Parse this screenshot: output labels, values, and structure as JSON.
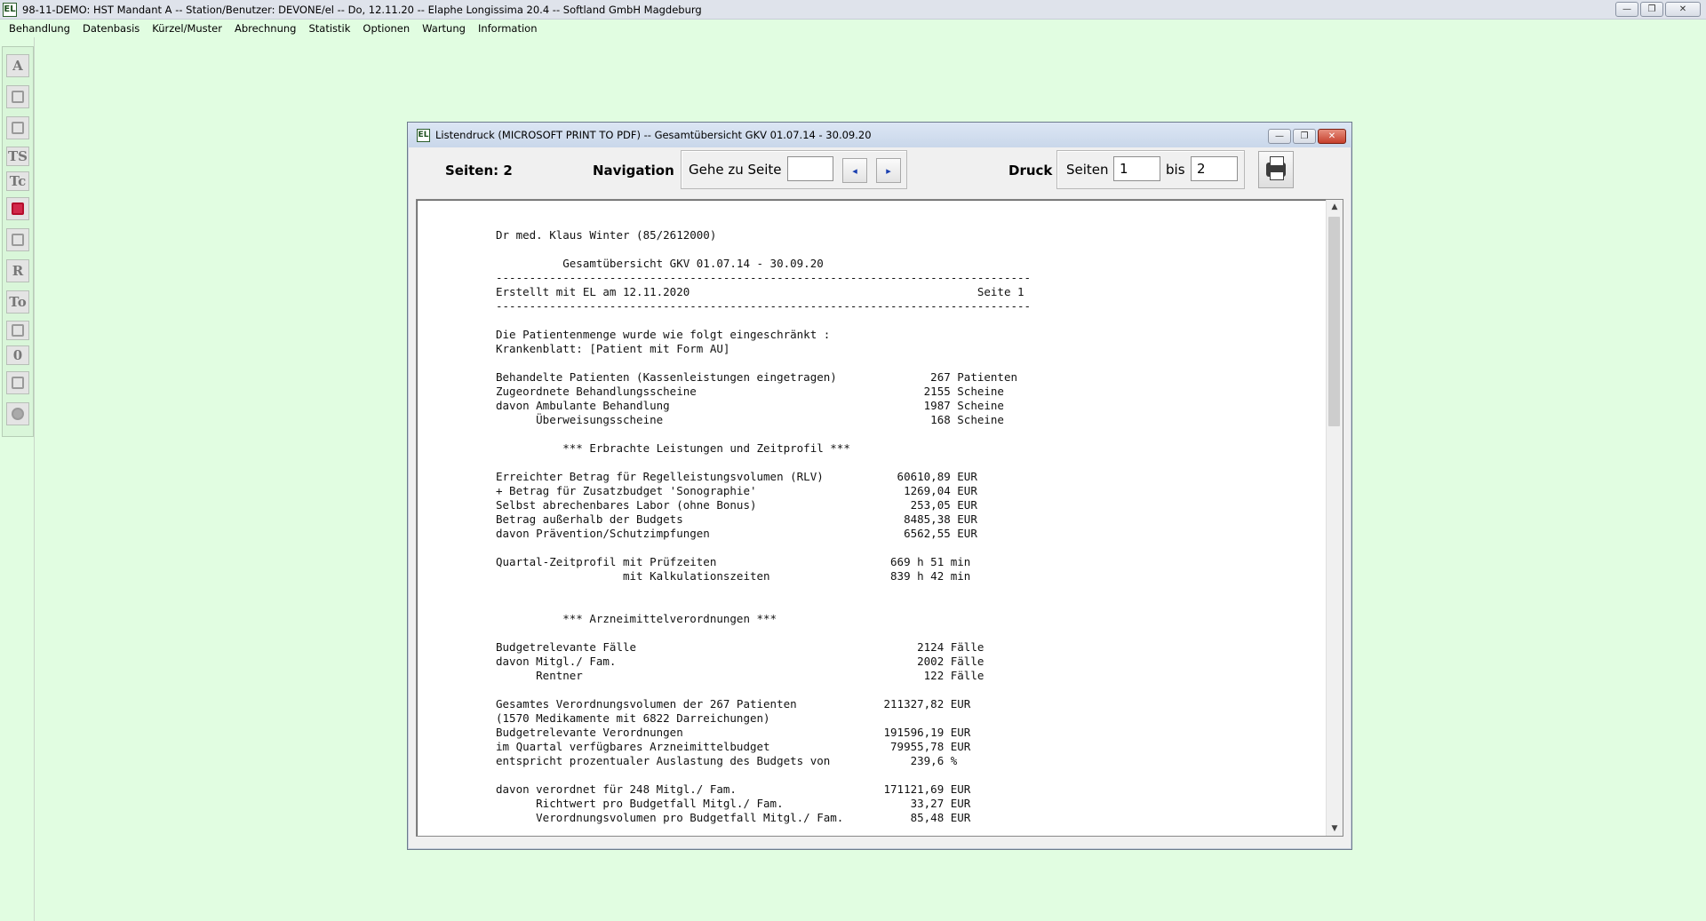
{
  "app": {
    "logo": "EL",
    "title": "98-11-DEMO: HST Mandant A -- Station/Benutzer: DEVONE/el -- Do, 12.11.20 -- Elaphe Longissima 20.4 -- Softland GmbH Magdeburg",
    "window_buttons": {
      "minimize": "—",
      "restore": "❐",
      "close": "✕"
    }
  },
  "menu": [
    "Behandlung",
    "Datenbasis",
    "Kürzel/Muster",
    "Abrechnung",
    "Statistik",
    "Optionen",
    "Wartung",
    "Information"
  ],
  "side_toolbar": [
    {
      "name": "tool-a-button",
      "label": "A",
      "icon": null
    },
    {
      "name": "tool-form-button",
      "label": "",
      "icon": "form-icon"
    },
    {
      "name": "tool-edit-button",
      "label": "",
      "icon": "edit-icon"
    },
    {
      "name": "tool-ts-button",
      "label": "TS",
      "icon": null
    },
    {
      "name": "tool-tc-button",
      "label": "Tc",
      "icon": null
    },
    {
      "name": "tool-book-button",
      "label": "",
      "icon": "book-icon"
    },
    {
      "name": "tool-list-button",
      "label": "",
      "icon": "list-icon"
    },
    {
      "name": "tool-r-button",
      "label": "R",
      "icon": null
    },
    {
      "name": "tool-to-button",
      "label": "To",
      "icon": null
    },
    {
      "name": "tool-print-button",
      "label": "",
      "icon": "printer-icon"
    },
    {
      "name": "tool-zero-button",
      "label": "0",
      "icon": null
    },
    {
      "name": "tool-chart-button",
      "label": "",
      "icon": "chart-icon"
    },
    {
      "name": "tool-disc-button",
      "label": "",
      "icon": "disc-icon"
    }
  ],
  "dialog": {
    "logo": "EL",
    "title": "Listendruck (MICROSOFT PRINT TO PDF) -- Gesamtübersicht GKV 01.07.14 - 30.09.20",
    "pages_label": "Seiten: 2",
    "navigation_label": "Navigation",
    "goto_label": "Gehe zu Seite",
    "goto_value": "",
    "first_page_icon": "◂",
    "last_page_icon": "▸",
    "print_label": "Druck",
    "print_pages_label": "Seiten",
    "print_from": "1",
    "print_to_label": "bis",
    "print_to": "2",
    "printer_icon": "printer-icon"
  },
  "document": {
    "lines": [
      "Dr med. Klaus Winter (85/2612000)",
      "",
      "          Gesamtübersicht GKV 01.07.14 - 30.09.20",
      "--------------------------------------------------------------------------------",
      "Erstellt mit EL am 12.11.2020                                           Seite 1",
      "--------------------------------------------------------------------------------",
      "",
      "Die Patientenmenge wurde wie folgt eingeschränkt :",
      "Krankenblatt: [Patient mit Form AU]",
      "",
      "Behandelte Patienten (Kassenleistungen eingetragen)              267 Patienten",
      "Zugeordnete Behandlungsscheine                                  2155 Scheine",
      "davon Ambulante Behandlung                                      1987 Scheine",
      "      Überweisungsscheine                                        168 Scheine",
      "",
      "          *** Erbrachte Leistungen und Zeitprofil ***",
      "",
      "Erreichter Betrag für Regelleistungsvolumen (RLV)           60610,89 EUR",
      "+ Betrag für Zusatzbudget 'Sonographie'                      1269,04 EUR",
      "Selbst abrechenbares Labor (ohne Bonus)                       253,05 EUR",
      "Betrag außerhalb der Budgets                                 8485,38 EUR",
      "davon Prävention/Schutzimpfungen                             6562,55 EUR",
      "",
      "Quartal-Zeitprofil mit Prüfzeiten                          669 h 51 min",
      "                   mit Kalkulationszeiten                  839 h 42 min",
      "",
      "",
      "          *** Arzneimittelverordnungen ***",
      "",
      "Budgetrelevante Fälle                                          2124 Fälle",
      "davon Mitgl./ Fam.                                             2002 Fälle",
      "      Rentner                                                   122 Fälle",
      "",
      "Gesamtes Verordnungsvolumen der 267 Patienten             211327,82 EUR",
      "(1570 Medikamente mit 6822 Darreichungen)",
      "Budgetrelevante Verordnungen                              191596,19 EUR",
      "im Quartal verfügbares Arzneimittelbudget                  79955,78 EUR",
      "entspricht prozentualer Auslastung des Budgets von            239,6 %",
      "",
      "davon verordnet für 248 Mitgl./ Fam.                      171121,69 EUR",
      "      Richtwert pro Budgetfall Mitgl./ Fam.                   33,27 EUR",
      "      Verordnungsvolumen pro Budgetfall Mitgl./ Fam.          85,48 EUR"
    ]
  },
  "scrollbar": {
    "up_icon": "▲",
    "down_icon": "▼"
  }
}
